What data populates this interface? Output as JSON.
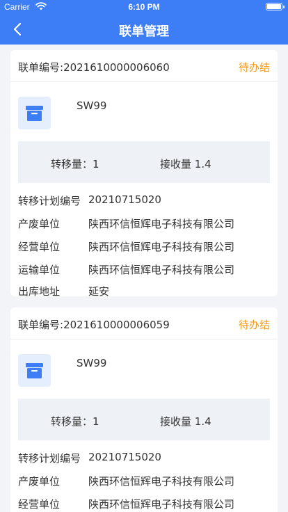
{
  "status_bar": {
    "carrier": "Carrier",
    "time": "6:10 PM"
  },
  "nav": {
    "title": "联单管理"
  },
  "cards": [
    {
      "no_label": "联单编号:",
      "no": "2021610000006060",
      "status": "待办结",
      "waste_code": "SW99",
      "transfer_qty_label": "转移量：",
      "transfer_qty": "1",
      "receive_qty_label": "接收量",
      "receive_qty": "1.4",
      "plan_no_label": "转移计划编号",
      "plan_no": "20210715020",
      "producer_label": "产废单位",
      "producer": "陕西环信恒辉电子科技有限公司",
      "operator_label": "经营单位",
      "operator": "陕西环信恒辉电子科技有限公司",
      "transporter_label": "运输单位",
      "transporter": "陕西环信恒辉电子科技有限公司",
      "outbound_label": "出库地址",
      "outbound": "延安"
    },
    {
      "no_label": "联单编号:",
      "no": "2021610000006059",
      "status": "待办结",
      "waste_code": "SW99",
      "transfer_qty_label": "转移量：",
      "transfer_qty": "1",
      "receive_qty_label": "接收量",
      "receive_qty": "1.4",
      "plan_no_label": "转移计划编号",
      "plan_no": "20210715020",
      "producer_label": "产废单位",
      "producer": "陕西环信恒辉电子科技有限公司",
      "operator_label": "经营单位",
      "operator": "陕西环信恒辉电子科技有限公司"
    }
  ],
  "colors": {
    "primary": "#3d7df5",
    "status_pending": "#f39a1f",
    "background": "#f2f4f7"
  },
  "icons": {
    "back": "chevron-left-icon",
    "archive": "archive-box-icon",
    "wifi": "wifi-icon",
    "battery": "battery-icon"
  }
}
